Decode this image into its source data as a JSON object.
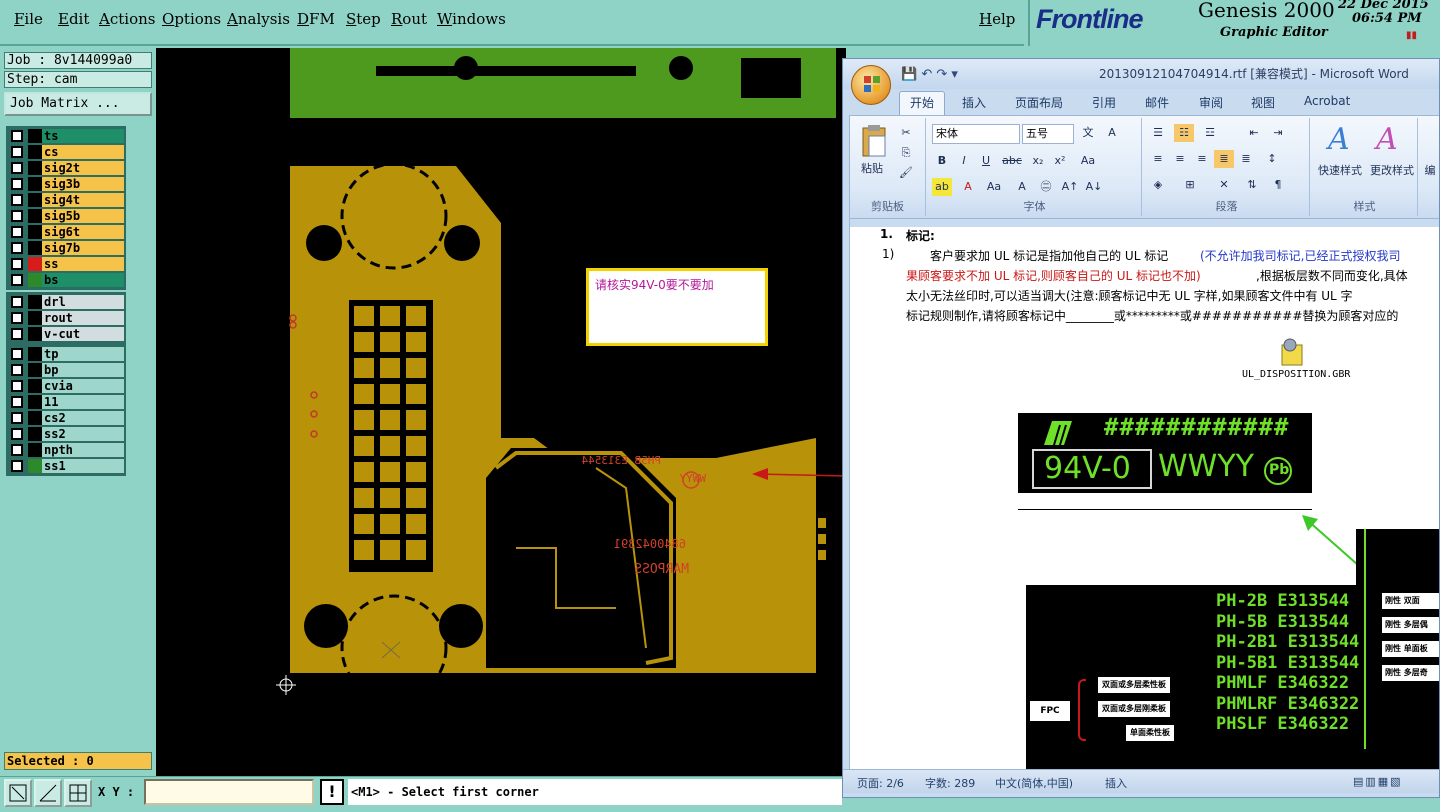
{
  "genesis": {
    "menu": [
      "File",
      "Edit",
      "Actions",
      "Options",
      "Analysis",
      "DFM",
      "Step",
      "Rout",
      "Windows"
    ],
    "help": "Help",
    "brand": {
      "logo": "Frontline",
      "title": "Genesis 2000",
      "subtitle": "Graphic Editor",
      "date": "22 Dec 2015",
      "time": "06:54 PM"
    },
    "job_label": "Job : 8v144099a0",
    "step_label": "Step: cam",
    "job_matrix_button": "Job Matrix ...",
    "layers_board": [
      {
        "name": "ts",
        "color": "#1f8f6a"
      },
      {
        "name": "cs",
        "color": "#f5c24a"
      },
      {
        "name": "sig2t",
        "color": "#f5c24a"
      },
      {
        "name": "sig3b",
        "color": "#f5c24a"
      },
      {
        "name": "sig4t",
        "color": "#f5c24a"
      },
      {
        "name": "sig5b",
        "color": "#f5c24a"
      },
      {
        "name": "sig6t",
        "color": "#f5c24a"
      },
      {
        "name": "sig7b",
        "color": "#f5c24a"
      },
      {
        "name": "ss",
        "color": "#f5c24a"
      },
      {
        "name": "bs",
        "color": "#1f8f6a"
      }
    ],
    "layers_drill": [
      {
        "name": "drl",
        "color": "#d2dde0"
      },
      {
        "name": "rout",
        "color": "#d2dde0"
      },
      {
        "name": "v-cut",
        "color": "#d2dde0"
      }
    ],
    "layers_misc": [
      {
        "name": "tp",
        "color": "#9fd6cb"
      },
      {
        "name": "bp",
        "color": "#9fd6cb"
      },
      {
        "name": "cvia",
        "color": "#9fd6cb"
      },
      {
        "name": "11",
        "color": "#9fd6cb"
      },
      {
        "name": "cs2",
        "color": "#9fd6cb"
      },
      {
        "name": "ss2",
        "color": "#9fd6cb"
      },
      {
        "name": "npth",
        "color": "#9fd6cb"
      },
      {
        "name": "ss1",
        "color": "#9fd6cb"
      }
    ],
    "selected_label": "Selected : 0",
    "xy_label": "X Y :",
    "xy_value": "",
    "warn_symbol": "!",
    "status_message": "<M1> - Select first corner",
    "note_text": "请核实94V-0要不要加",
    "pcb_text": {
      "mirror_ul": "PH5B E313544",
      "mirror_code": "6840042391",
      "mirror_brand": "MARPOSS",
      "mirror_date": "WWYY"
    }
  },
  "word": {
    "title": "20130912104704914.rtf [兼容模式] - Microsoft Word",
    "tabs": [
      "开始",
      "插入",
      "页面布局",
      "引用",
      "邮件",
      "审阅",
      "视图",
      "Acrobat"
    ],
    "font_name": "宋体",
    "font_size": "五号",
    "groups": {
      "clipboard": "剪贴板",
      "font": "字体",
      "paragraph": "段落",
      "styles": "样式"
    },
    "paste_label": "粘贴",
    "quick_styles_label": "快速样式",
    "change_styles_label": "更改样式",
    "edit_label": "编",
    "doc": {
      "heading_num": "1.",
      "heading": "标记:",
      "item_num": "1)",
      "line1_a": "客户要求加 UL 标记是指加他自己的 UL 标记",
      "line1_b": "(不允许加我司标记,已经正式授权我司",
      "line2_a": "果顾客要求不加 UL 标记,则顾客自己的 UL 标记也不加)",
      "line2_b": ",根据板层数不同而变化,具体",
      "line3": "太小无法丝印时,可以适当调大(注意:顾客标记中无 UL 字样,如果顾客文件中有 UL 字",
      "line4": "标记规则制作,请将顾客标记中________或*********或###########替换为顾客对应的",
      "attachment_name": "UL_DISPOSITION.GBR",
      "ul_hash": "############",
      "ul_94v": "94V-0",
      "ul_wwyy": "WWYY",
      "ul_pb": "Pb"
    },
    "ul_table": {
      "codes": [
        "PH-2B E313544",
        "PH-5B E313544",
        "PH-2B1 E313544",
        "PH-5B1 E313544",
        "PHMLF E346322",
        "PHMLRF E346322",
        "PHSLF E346322"
      ],
      "right_labels": [
        "刚性 双面",
        "刚性 多层偶",
        "刚性 单面板",
        "刚性 多层奇"
      ],
      "left_labels": [
        "双面或多层柔性板",
        "双面或多层刚柔板",
        "单面柔性板"
      ],
      "fpc_label": "FPC"
    },
    "status": {
      "page": "页面: 2/6",
      "words": "字数: 289",
      "language": "中文(简体,中国)",
      "mode": "插入"
    }
  }
}
